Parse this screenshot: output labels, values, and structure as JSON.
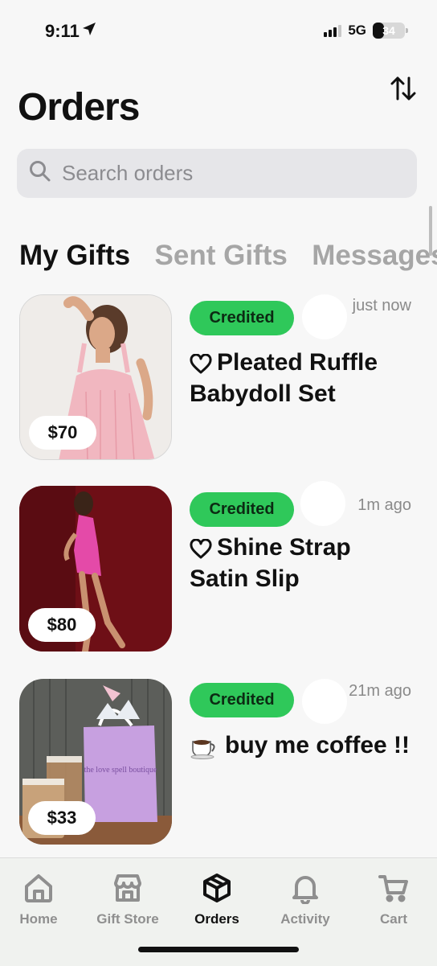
{
  "status": {
    "time": "9:11",
    "network": "5G",
    "battery": "34"
  },
  "header": {
    "title": "Orders"
  },
  "search": {
    "placeholder": "Search orders"
  },
  "tabs": [
    "My Gifts",
    "Sent Gifts",
    "Messages"
  ],
  "orders": [
    {
      "price": "$70",
      "status": "Credited",
      "time": "just now",
      "icon": "heart-icon",
      "title": "Pleated Ruffle Babydoll Set"
    },
    {
      "price": "$80",
      "status": "Credited",
      "time": "1m ago",
      "icon": "heart-icon",
      "title": "Shine Strap Satin Slip"
    },
    {
      "price": "$33",
      "status": "Credited",
      "time": "21m ago",
      "icon": "coffee-icon",
      "title": "buy me coffee !!",
      "bag_text": "the love spell boutique"
    }
  ],
  "nav": [
    {
      "label": "Home",
      "icon": "home-icon"
    },
    {
      "label": "Gift Store",
      "icon": "store-icon"
    },
    {
      "label": "Orders",
      "icon": "box-icon"
    },
    {
      "label": "Activity",
      "icon": "bell-icon"
    },
    {
      "label": "Cart",
      "icon": "cart-icon"
    }
  ],
  "colors": {
    "accent": "#2fc85a",
    "background": "#f7f7f7",
    "inactive": "#a6a6a6"
  }
}
